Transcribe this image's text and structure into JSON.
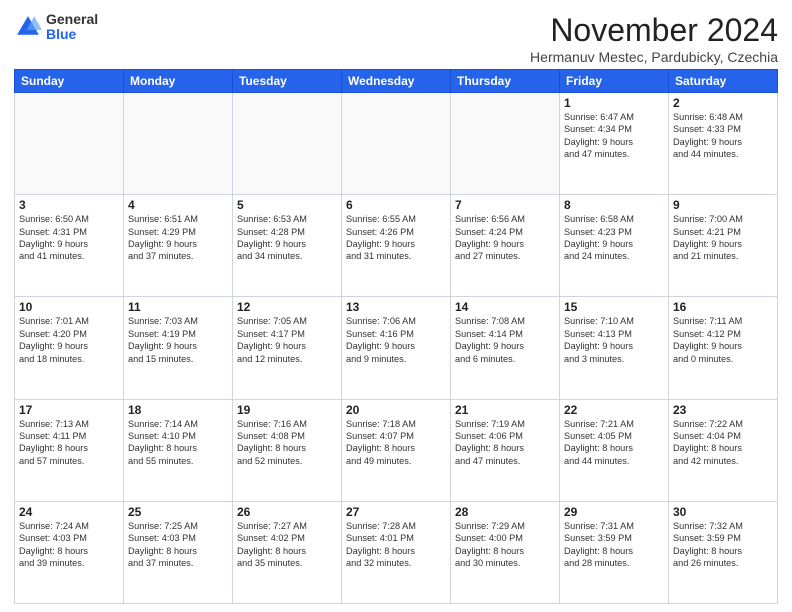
{
  "logo": {
    "general": "General",
    "blue": "Blue"
  },
  "title": "November 2024",
  "subtitle": "Hermanuv Mestec, Pardubicky, Czechia",
  "header": {
    "days": [
      "Sunday",
      "Monday",
      "Tuesday",
      "Wednesday",
      "Thursday",
      "Friday",
      "Saturday"
    ]
  },
  "weeks": [
    [
      {
        "day": "",
        "info": ""
      },
      {
        "day": "",
        "info": ""
      },
      {
        "day": "",
        "info": ""
      },
      {
        "day": "",
        "info": ""
      },
      {
        "day": "",
        "info": ""
      },
      {
        "day": "1",
        "info": "Sunrise: 6:47 AM\nSunset: 4:34 PM\nDaylight: 9 hours\nand 47 minutes."
      },
      {
        "day": "2",
        "info": "Sunrise: 6:48 AM\nSunset: 4:33 PM\nDaylight: 9 hours\nand 44 minutes."
      }
    ],
    [
      {
        "day": "3",
        "info": "Sunrise: 6:50 AM\nSunset: 4:31 PM\nDaylight: 9 hours\nand 41 minutes."
      },
      {
        "day": "4",
        "info": "Sunrise: 6:51 AM\nSunset: 4:29 PM\nDaylight: 9 hours\nand 37 minutes."
      },
      {
        "day": "5",
        "info": "Sunrise: 6:53 AM\nSunset: 4:28 PM\nDaylight: 9 hours\nand 34 minutes."
      },
      {
        "day": "6",
        "info": "Sunrise: 6:55 AM\nSunset: 4:26 PM\nDaylight: 9 hours\nand 31 minutes."
      },
      {
        "day": "7",
        "info": "Sunrise: 6:56 AM\nSunset: 4:24 PM\nDaylight: 9 hours\nand 27 minutes."
      },
      {
        "day": "8",
        "info": "Sunrise: 6:58 AM\nSunset: 4:23 PM\nDaylight: 9 hours\nand 24 minutes."
      },
      {
        "day": "9",
        "info": "Sunrise: 7:00 AM\nSunset: 4:21 PM\nDaylight: 9 hours\nand 21 minutes."
      }
    ],
    [
      {
        "day": "10",
        "info": "Sunrise: 7:01 AM\nSunset: 4:20 PM\nDaylight: 9 hours\nand 18 minutes."
      },
      {
        "day": "11",
        "info": "Sunrise: 7:03 AM\nSunset: 4:19 PM\nDaylight: 9 hours\nand 15 minutes."
      },
      {
        "day": "12",
        "info": "Sunrise: 7:05 AM\nSunset: 4:17 PM\nDaylight: 9 hours\nand 12 minutes."
      },
      {
        "day": "13",
        "info": "Sunrise: 7:06 AM\nSunset: 4:16 PM\nDaylight: 9 hours\nand 9 minutes."
      },
      {
        "day": "14",
        "info": "Sunrise: 7:08 AM\nSunset: 4:14 PM\nDaylight: 9 hours\nand 6 minutes."
      },
      {
        "day": "15",
        "info": "Sunrise: 7:10 AM\nSunset: 4:13 PM\nDaylight: 9 hours\nand 3 minutes."
      },
      {
        "day": "16",
        "info": "Sunrise: 7:11 AM\nSunset: 4:12 PM\nDaylight: 9 hours\nand 0 minutes."
      }
    ],
    [
      {
        "day": "17",
        "info": "Sunrise: 7:13 AM\nSunset: 4:11 PM\nDaylight: 8 hours\nand 57 minutes."
      },
      {
        "day": "18",
        "info": "Sunrise: 7:14 AM\nSunset: 4:10 PM\nDaylight: 8 hours\nand 55 minutes."
      },
      {
        "day": "19",
        "info": "Sunrise: 7:16 AM\nSunset: 4:08 PM\nDaylight: 8 hours\nand 52 minutes."
      },
      {
        "day": "20",
        "info": "Sunrise: 7:18 AM\nSunset: 4:07 PM\nDaylight: 8 hours\nand 49 minutes."
      },
      {
        "day": "21",
        "info": "Sunrise: 7:19 AM\nSunset: 4:06 PM\nDaylight: 8 hours\nand 47 minutes."
      },
      {
        "day": "22",
        "info": "Sunrise: 7:21 AM\nSunset: 4:05 PM\nDaylight: 8 hours\nand 44 minutes."
      },
      {
        "day": "23",
        "info": "Sunrise: 7:22 AM\nSunset: 4:04 PM\nDaylight: 8 hours\nand 42 minutes."
      }
    ],
    [
      {
        "day": "24",
        "info": "Sunrise: 7:24 AM\nSunset: 4:03 PM\nDaylight: 8 hours\nand 39 minutes."
      },
      {
        "day": "25",
        "info": "Sunrise: 7:25 AM\nSunset: 4:03 PM\nDaylight: 8 hours\nand 37 minutes."
      },
      {
        "day": "26",
        "info": "Sunrise: 7:27 AM\nSunset: 4:02 PM\nDaylight: 8 hours\nand 35 minutes."
      },
      {
        "day": "27",
        "info": "Sunrise: 7:28 AM\nSunset: 4:01 PM\nDaylight: 8 hours\nand 32 minutes."
      },
      {
        "day": "28",
        "info": "Sunrise: 7:29 AM\nSunset: 4:00 PM\nDaylight: 8 hours\nand 30 minutes."
      },
      {
        "day": "29",
        "info": "Sunrise: 7:31 AM\nSunset: 3:59 PM\nDaylight: 8 hours\nand 28 minutes."
      },
      {
        "day": "30",
        "info": "Sunrise: 7:32 AM\nSunset: 3:59 PM\nDaylight: 8 hours\nand 26 minutes."
      }
    ]
  ]
}
